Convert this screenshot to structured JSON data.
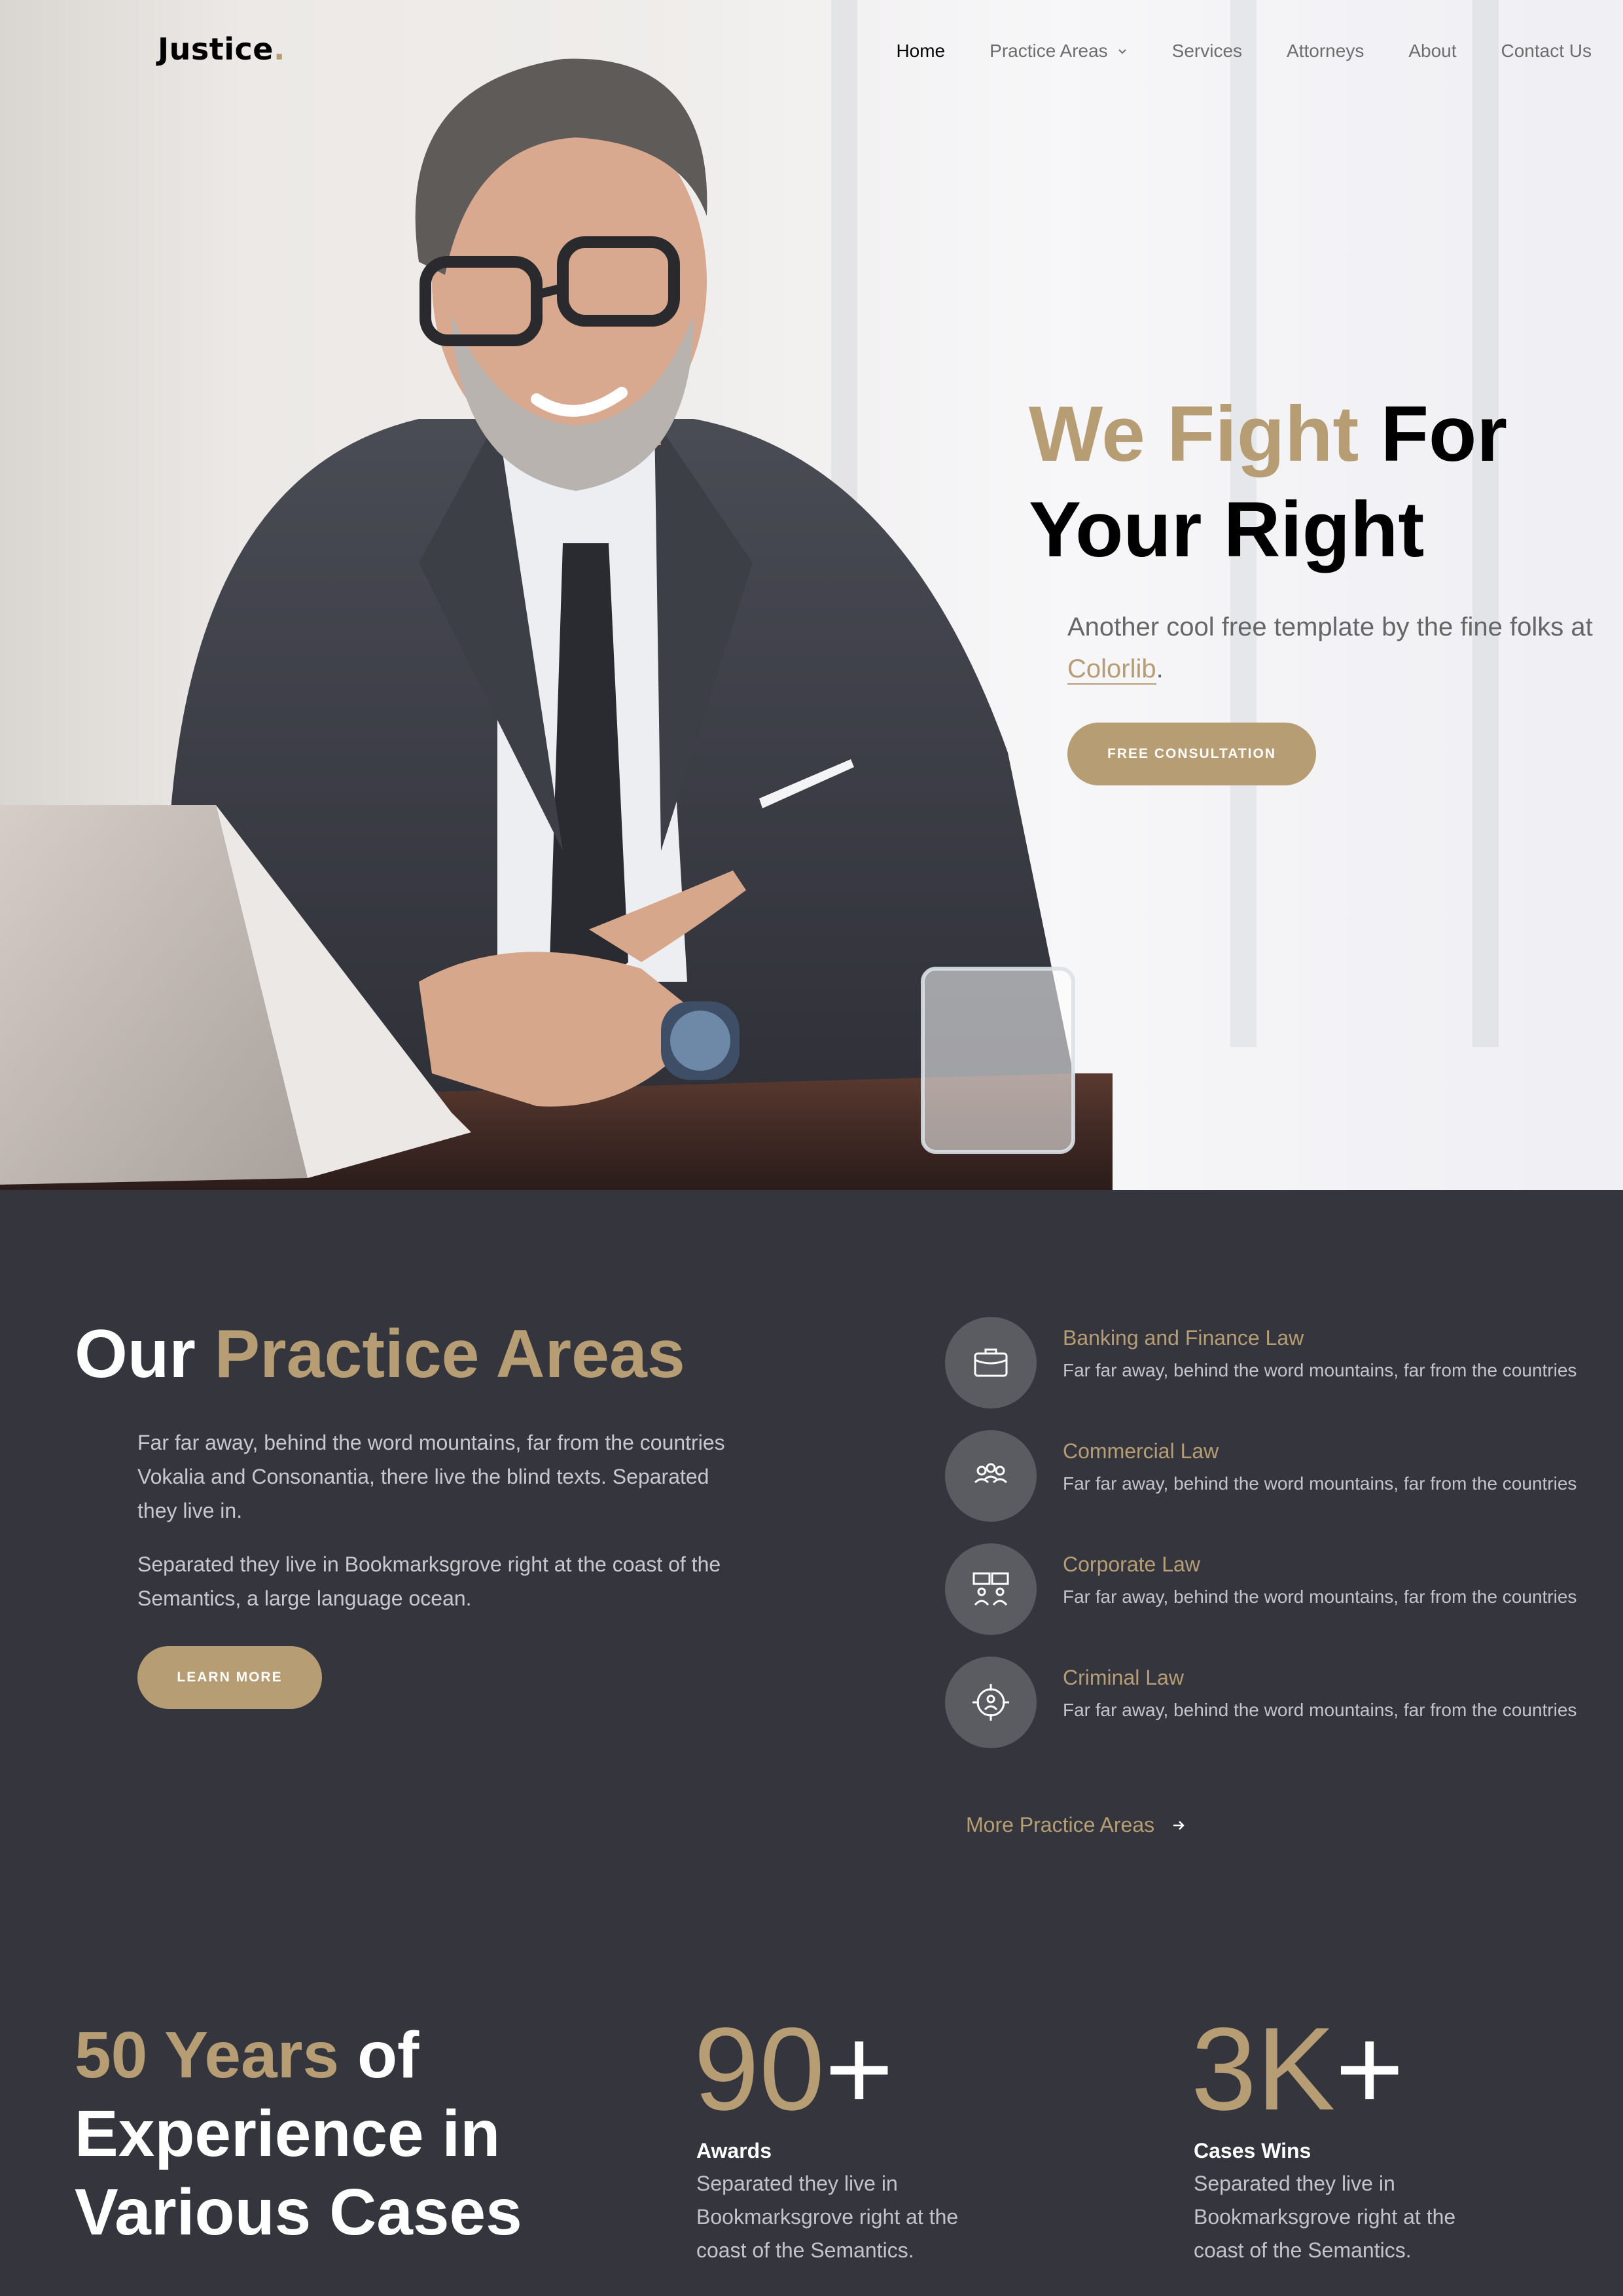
{
  "nav": {
    "logo": "Justice",
    "logo_dot": ".",
    "items": [
      {
        "label": "Home"
      },
      {
        "label": "Practice Areas"
      },
      {
        "label": "Services"
      },
      {
        "label": "Attorneys"
      },
      {
        "label": "About"
      },
      {
        "label": "Contact Us"
      }
    ]
  },
  "hero": {
    "title_accent": "We Fight",
    "title_rest1": " For",
    "title_rest2": "Your Right",
    "subtitle_pre": "Another cool free template by the fine folks at ",
    "subtitle_link": "Colorlib",
    "subtitle_post": ".",
    "button": "FREE CONSULTATION"
  },
  "practice": {
    "title_plain": "Our ",
    "title_accent": "Practice Areas",
    "paragraph1": "Far far away, behind the word mountains, far from the countries Vokalia and Consonantia, there live the blind texts. Separated they live in.",
    "paragraph2": "Separated they live in Bookmarksgrove right at the coast of the Semantics, a large language ocean.",
    "button": "LEARN MORE",
    "areas": [
      {
        "name": "Banking and Finance Law",
        "desc": "Far far away, behind the word mountains, far from the countries",
        "icon": "briefcase-icon"
      },
      {
        "name": "Commercial Law",
        "desc": "Far far away, behind the word mountains, far from the countries",
        "icon": "people-icon"
      },
      {
        "name": "Corporate Law",
        "desc": "Far far away, behind the word mountains, far from the countries",
        "icon": "meeting-icon"
      },
      {
        "name": "Criminal Law",
        "desc": "Far far away, behind the word mountains, far from the countries",
        "icon": "target-person-icon"
      }
    ],
    "more_link": "More Practice Areas"
  },
  "stats": {
    "title_accent": "50 Years",
    "title_rest1": " of",
    "title_rest2": "Experience in",
    "title_rest3": "Various Cases",
    "items": [
      {
        "number": "90",
        "plus": "+",
        "label": "Awards",
        "desc": "Separated they live in Bookmarksgrove right at the coast of the Semantics."
      },
      {
        "number": "3K",
        "plus": "+",
        "label": "Cases Wins",
        "desc": "Separated they live in Bookmarksgrove right at the coast of the Semantics."
      }
    ]
  },
  "colors": {
    "accent": "#b69d74",
    "dark_bg": "#35363d",
    "icon_circle": "#5b5b62"
  }
}
